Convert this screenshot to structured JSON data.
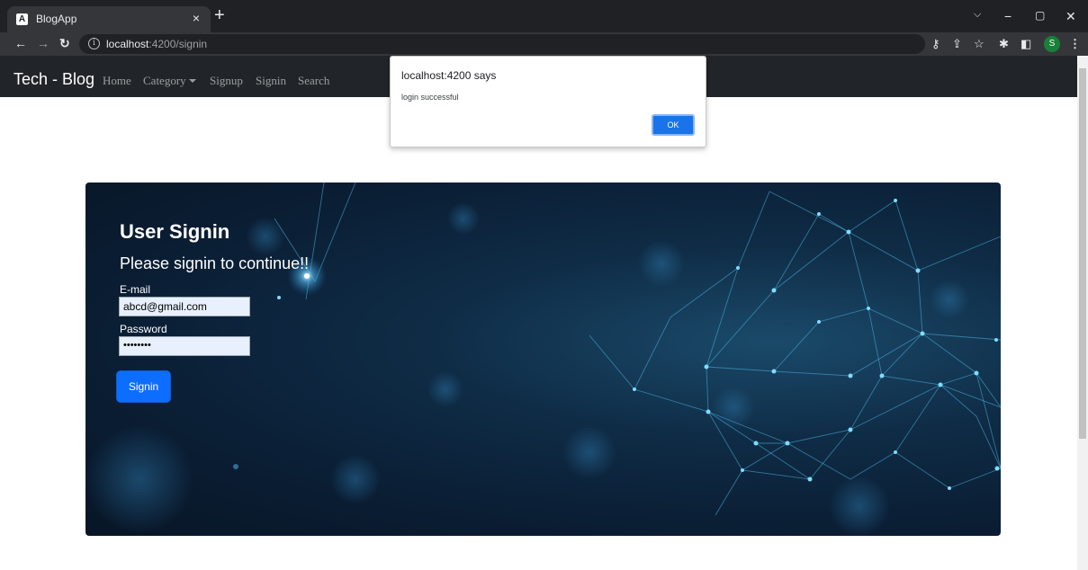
{
  "browser": {
    "tab_title": "BlogApp",
    "tab_favicon": "A",
    "tab_close": "×",
    "new_tab": "+",
    "url_host": "localhost",
    "url_rest": ":4200/signin",
    "profile_initial": "S"
  },
  "navbar": {
    "brand": "Tech - Blog",
    "links": [
      "Home",
      "Category",
      "Signup",
      "Signin",
      "Search"
    ]
  },
  "signin": {
    "title": "User Signin",
    "subtitle": "Please signin to continue!!",
    "email_label": "E-mail",
    "email_value": "abcd@gmail.com",
    "password_label": "Password",
    "password_value": "••••••••",
    "button": "Signin"
  },
  "dialog": {
    "title": "localhost:4200 says",
    "message": "login successful",
    "ok": "OK"
  },
  "colors": {
    "navbar": "#212529",
    "primary_button": "#0d6efd",
    "dialog_button": "#1a73e8",
    "hero_bg": "#0a1d33"
  }
}
